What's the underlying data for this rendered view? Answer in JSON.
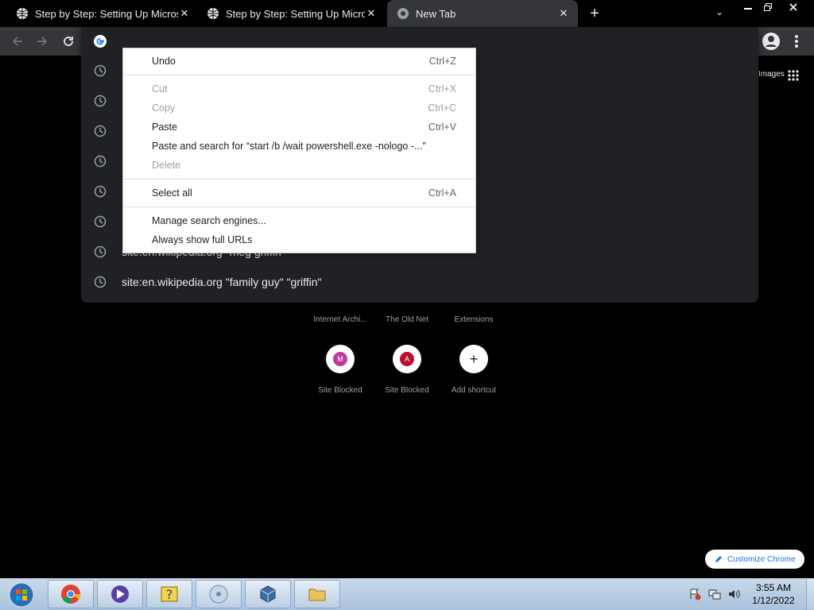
{
  "tabs": [
    {
      "title": "Step by Step: Setting Up Microsc",
      "icon": "globe-icon"
    },
    {
      "title": "Step by Step: Setting Up Microsc",
      "icon": "globe-icon"
    },
    {
      "title": "New Tab",
      "icon": "chrome-icon"
    }
  ],
  "omnibox": {
    "suggestions": [
      {
        "text": ""
      },
      {
        "text": ""
      },
      {
        "text": ""
      },
      {
        "text": ""
      },
      {
        "text": ""
      },
      {
        "text": ""
      },
      {
        "text": "site:en.wikipedia.org \"meg griffin\""
      },
      {
        "text": "site:en.wikipedia.org \"family guy\" \"griffin\""
      }
    ]
  },
  "context_menu": {
    "undo": {
      "label": "Undo",
      "shortcut": "Ctrl+Z"
    },
    "cut": {
      "label": "Cut",
      "shortcut": "Ctrl+X"
    },
    "copy": {
      "label": "Copy",
      "shortcut": "Ctrl+C"
    },
    "paste": {
      "label": "Paste",
      "shortcut": "Ctrl+V"
    },
    "paste_search": {
      "label": "Paste and search for “start /b /wait powershell.exe -nologo -...”"
    },
    "delete": {
      "label": "Delete"
    },
    "select_all": {
      "label": "Select all",
      "shortcut": "Ctrl+A"
    },
    "manage_engines": {
      "label": "Manage search engines..."
    },
    "show_urls": {
      "label": "Always show full URLs"
    }
  },
  "ntp": {
    "images_link": "Images",
    "shortcuts_row1": [
      {
        "label": "Internet Archi..."
      },
      {
        "label": "The Old Net"
      },
      {
        "label": "Extensions"
      }
    ],
    "shortcuts_row2": [
      {
        "label": "Site Blocked",
        "letter": "M",
        "color": "#c0399f"
      },
      {
        "label": "Site Blocked",
        "letter": "A",
        "color": "#b3122e"
      },
      {
        "label": "Add shortcut",
        "letter": "+"
      }
    ],
    "customize": "Customize Chrome"
  },
  "taskbar": {
    "time": "3:55 AM",
    "date": "1/12/2022"
  },
  "colors": {
    "tab_active": "#35363a",
    "dropdown": "#202124",
    "accent": "#1a73e8"
  }
}
